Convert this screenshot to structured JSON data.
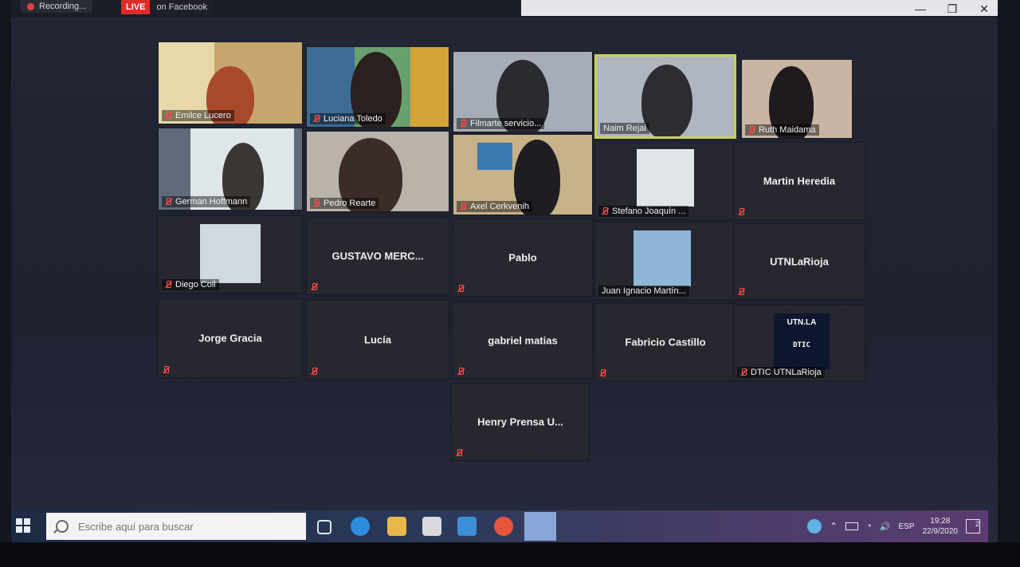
{
  "topbar": {
    "recording": "Recording...",
    "live_badge": "LIVE",
    "live_text": "on Facebook"
  },
  "window_controls": {
    "minimize": "—",
    "restore": "❐",
    "close": "✕"
  },
  "participants": [
    {
      "name": "Emilce Lucero",
      "video": true
    },
    {
      "name": "Luciana Toledo",
      "video": true
    },
    {
      "name": "Filmarte servicio...",
      "video": true
    },
    {
      "name": "Naim Rejal",
      "video": true,
      "active_speaker": true
    },
    {
      "name": "Ruth Maidama",
      "video": true
    },
    {
      "name": "German Hoffmann",
      "video": true
    },
    {
      "name": "Pedro Rearte",
      "video": true
    },
    {
      "name": "Axel Cerkvenih",
      "video": true
    },
    {
      "name": "Stefano Joaquín ...",
      "video": false,
      "picture": true
    },
    {
      "name": "Martin Heredia",
      "video": false
    },
    {
      "name": "Diego Coll",
      "video": false,
      "picture": true
    },
    {
      "name": "GUSTAVO MERC...",
      "video": false
    },
    {
      "name": "Pablo",
      "video": false
    },
    {
      "name": "Juan Ignacio Martín...",
      "video": false,
      "picture": true
    },
    {
      "name": "UTNLaRioja",
      "video": false
    },
    {
      "name": "Jorge Gracia",
      "video": false
    },
    {
      "name": "Lucía",
      "video": false
    },
    {
      "name": "gabriel matias",
      "video": false
    },
    {
      "name": "Fabricio Castillo",
      "video": false
    },
    {
      "name": "DTIC UTNLaRioja",
      "video": false,
      "picture": true
    },
    {
      "name": "Henry Prensa U...",
      "video": false
    }
  ],
  "logo": {
    "line1": "UTN.LA",
    "line2": "DTIC"
  },
  "taskbar": {
    "search_placeholder": "Escribe aquí para buscar",
    "language": "ESP",
    "time": "19:28",
    "date": "22/9/2020",
    "notifications": "2"
  },
  "colors": {
    "active_border": "#c9d34a",
    "live": "#e02b2b",
    "muted_icon": "#ff3b3b"
  }
}
